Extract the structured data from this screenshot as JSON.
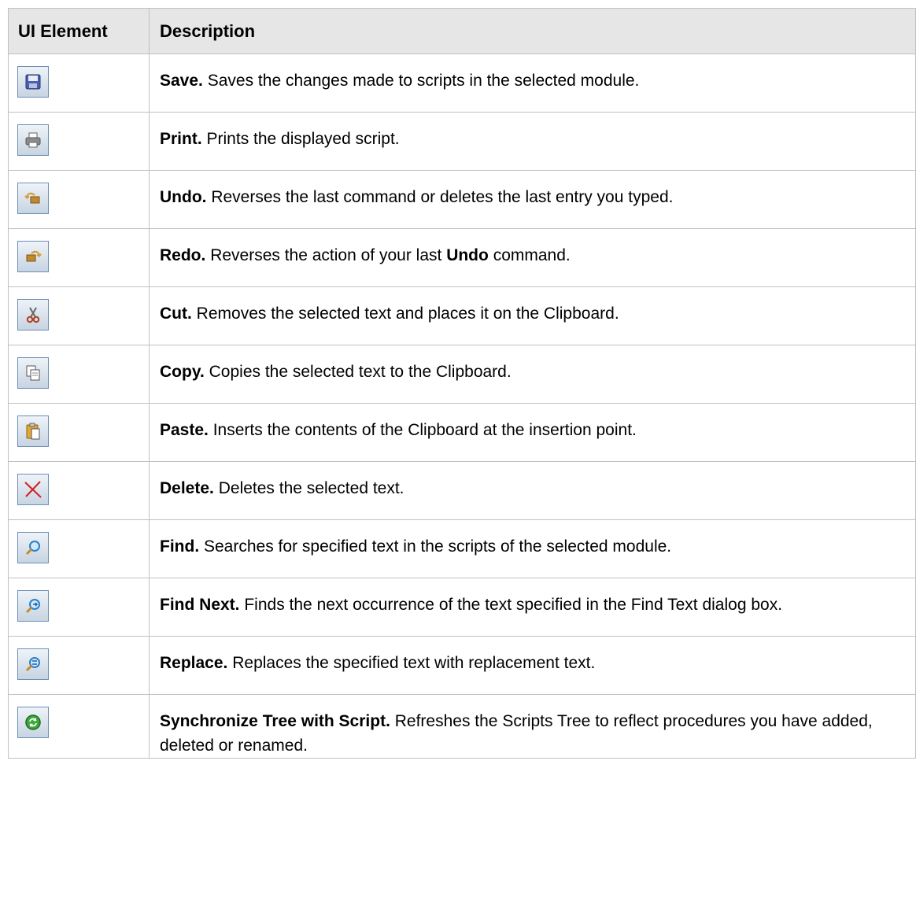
{
  "table": {
    "headers": {
      "element": "UI Element",
      "description": "Description"
    },
    "rows": [
      {
        "icon": "save-icon",
        "name": "Save.",
        "text": "Saves the changes made to scripts in the selected module."
      },
      {
        "icon": "print-icon",
        "name": "Print.",
        "text": "Prints the displayed script."
      },
      {
        "icon": "undo-icon",
        "name": "Undo.",
        "text": "Reverses the last command or deletes the last entry you typed."
      },
      {
        "icon": "redo-icon",
        "name": "Redo.",
        "text_before": "Reverses the action of your last",
        "bold_inline": "Undo",
        "text_after": "command."
      },
      {
        "icon": "cut-icon",
        "name": "Cut.",
        "text": "Removes the selected text and places it on the Clipboard."
      },
      {
        "icon": "copy-icon",
        "name": "Copy.",
        "text": "Copies the selected text to the Clipboard."
      },
      {
        "icon": "paste-icon",
        "name": "Paste.",
        "text": "Inserts the contents of the Clipboard at the insertion point."
      },
      {
        "icon": "delete-icon",
        "name": "Delete.",
        "text": "Deletes the selected text."
      },
      {
        "icon": "find-icon",
        "name": "Find.",
        "text": "Searches for specified text in the scripts of the selected module."
      },
      {
        "icon": "find-next-icon",
        "name": "Find Next.",
        "text": "Finds the next occurrence of the text specified in the Find Text dialog box."
      },
      {
        "icon": "replace-icon",
        "name": "Replace.",
        "text": "Replaces the specified text with replacement text."
      },
      {
        "icon": "sync-tree-icon",
        "name": "Synchronize Tree with Script.",
        "text": "Refreshes the Scripts Tree to reflect procedures you have added, deleted or renamed."
      }
    ]
  }
}
